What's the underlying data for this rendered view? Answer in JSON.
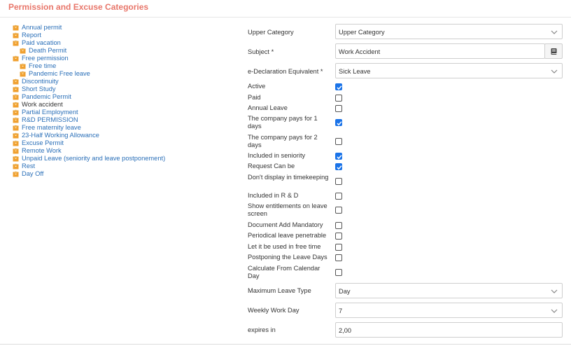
{
  "header": {
    "title": "Permission and Excuse Categories"
  },
  "tree": [
    {
      "label": "Annual permit",
      "level": 0,
      "dark": false
    },
    {
      "label": "Report",
      "level": 0,
      "dark": false
    },
    {
      "label": "Paid vacation",
      "level": 0,
      "dark": false
    },
    {
      "label": "Death Permit",
      "level": 1,
      "dark": false
    },
    {
      "label": "Free permission",
      "level": 0,
      "dark": false
    },
    {
      "label": "Free time",
      "level": 1,
      "dark": false
    },
    {
      "label": "Pandemic Free leave",
      "level": 1,
      "dark": false
    },
    {
      "label": "Discontinuity",
      "level": 0,
      "dark": false
    },
    {
      "label": "Short Study",
      "level": 0,
      "dark": false
    },
    {
      "label": "Pandemic Permit",
      "level": 0,
      "dark": false
    },
    {
      "label": "Work accident",
      "level": 0,
      "dark": true
    },
    {
      "label": "Partial Employment",
      "level": 0,
      "dark": false
    },
    {
      "label": "R&D PERMISSION",
      "level": 0,
      "dark": false
    },
    {
      "label": "Free maternity leave",
      "level": 0,
      "dark": false
    },
    {
      "label": "23-Half Working Allowance",
      "level": 0,
      "dark": false
    },
    {
      "label": "Excuse Permit",
      "level": 0,
      "dark": false
    },
    {
      "label": "Remote Work",
      "level": 0,
      "dark": false
    },
    {
      "label": "Unpaid Leave (seniority and leave postponement)",
      "level": 0,
      "dark": false
    },
    {
      "label": "Rest",
      "level": 0,
      "dark": false
    },
    {
      "label": "Day Off",
      "level": 0,
      "dark": false
    }
  ],
  "form": {
    "upper_category": {
      "label": "Upper Category",
      "value": "Upper Category"
    },
    "subject": {
      "label": "Subject *",
      "value": "Work Accident"
    },
    "edeclaration": {
      "label": "e-Declaration Equivalent *",
      "value": "Sick Leave"
    },
    "checkboxes": [
      {
        "label": "Active",
        "checked": true
      },
      {
        "label": "Paid",
        "checked": false
      },
      {
        "label": "Annual Leave",
        "checked": false
      },
      {
        "label": "The company pays for 1 days",
        "checked": true
      },
      {
        "label": "The company pays for 2 days",
        "checked": false
      },
      {
        "label": "Included in seniority",
        "checked": true
      },
      {
        "label": "Request Can be",
        "checked": true
      },
      {
        "label": "Don't display in timekeeping",
        "checked": false
      },
      {
        "label": "Included in R & D",
        "checked": false
      },
      {
        "label": "Show entitlements on leave screen",
        "checked": false
      },
      {
        "label": "Document Add Mandatory",
        "checked": false
      },
      {
        "label": "Periodical leave penetrable",
        "checked": false
      },
      {
        "label": "Let it be used in free time",
        "checked": false
      },
      {
        "label": "Postponing the Leave Days",
        "checked": false
      },
      {
        "label": "Calculate From Calendar Day",
        "checked": false
      }
    ],
    "max_leave_type": {
      "label": "Maximum Leave Type",
      "value": "Day"
    },
    "weekly_work_day": {
      "label": "Weekly Work Day",
      "value": "7"
    },
    "expires_in": {
      "label": "expires in",
      "value": "2,00"
    }
  },
  "colors": {
    "title": "#e8766a",
    "link": "#2a6fb8",
    "checkbox": "#1a73e8",
    "folder": "#f0a030"
  }
}
